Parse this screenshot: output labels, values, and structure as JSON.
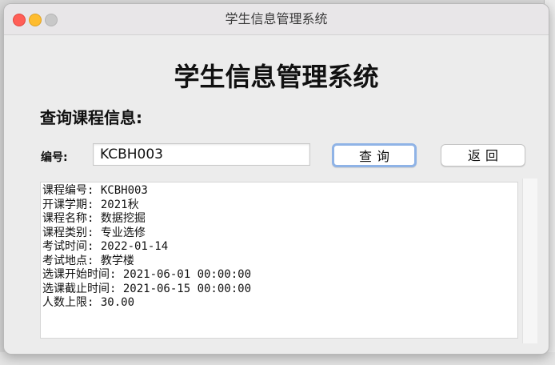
{
  "window": {
    "title": "学生信息管理系统"
  },
  "heading": "学生信息管理系统",
  "subheading": "查询课程信息:",
  "form": {
    "id_label": "编号:",
    "id_value": "KCBH003",
    "query_button": "查询",
    "back_button": "返回"
  },
  "result": {
    "lines": [
      "课程编号: KCBH003",
      "开课学期: 2021秋",
      "课程名称: 数据挖掘",
      "课程类别: 专业选修",
      "考试时间: 2022-01-14",
      "考试地点: 教学楼",
      "选课开始时间: 2021-06-01 00:00:00",
      "选课截止时间: 2021-06-15 00:00:00",
      "人数上限: 30.00"
    ]
  },
  "colors": {
    "close": "#ff5f57",
    "minimize": "#febc2e",
    "zoom_inactive": "#c8c8c8",
    "focus_ring": "#8fb3e6"
  }
}
